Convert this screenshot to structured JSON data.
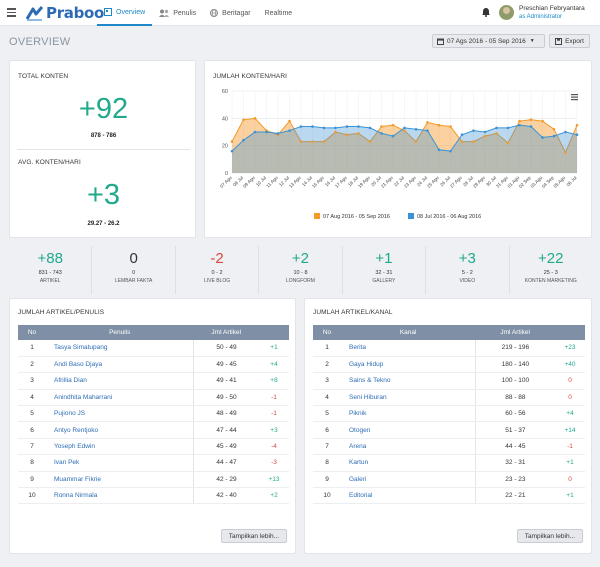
{
  "header": {
    "logo": "Praboo",
    "nav": [
      "Overview",
      "Penulis",
      "Beritagar",
      "Realtime"
    ],
    "user_name": "Preschian Febryantara",
    "user_role": "as Administrator"
  },
  "page": {
    "title": "OVERVIEW",
    "date_range": "07 Ags 2016 - 05 Sep 2016",
    "export_label": "Export"
  },
  "total": {
    "title": "TOTAL KONTEN",
    "value": "+92",
    "range": "878 - 786",
    "avg_title": "AVG. KONTEN/HARI",
    "avg_value": "+3",
    "avg_range": "29.27 - 26.2"
  },
  "chart_data": {
    "type": "area",
    "title": "JUMLAH KONTEN/HARI",
    "ylim": [
      0,
      60
    ],
    "yticks": [
      "0",
      "20",
      "40",
      "60"
    ],
    "x": [
      "07 Agu",
      "08 Jul",
      "09 Agu",
      "10 Jul",
      "11 Agu",
      "12 Jul",
      "13 Agu",
      "14 Jul",
      "15 Agu",
      "16 Jul",
      "17 Agu",
      "18 Jul",
      "19 Agu",
      "20 Jul",
      "21 Agu",
      "22 Jul",
      "23 Agu",
      "24 Jul",
      "25 Agu",
      "26 Jul",
      "27 Agu",
      "28 Jul",
      "29 Agu",
      "30 Jul",
      "31 Agu",
      "01 Agu",
      "02 Sep",
      "03 Agu",
      "04 Sep",
      "05 Agu",
      "06 Jul"
    ],
    "grid": true,
    "legend_position": "bottom",
    "series": [
      {
        "name": "07 Aug 2016 - 05 Sep 2016",
        "color": "#f39a2b",
        "values": [
          23,
          39,
          40,
          31,
          28,
          38,
          23,
          23,
          23,
          30,
          28,
          29,
          23,
          34,
          35,
          31,
          23,
          37,
          35,
          34,
          23,
          23,
          27,
          29,
          22,
          38,
          39,
          38,
          32,
          15,
          35
        ]
      },
      {
        "name": "08 Jul 2016 - 06 Aug 2016",
        "color": "#3a93d6",
        "values": [
          16,
          24,
          30,
          30,
          29,
          31,
          34,
          34,
          33,
          33,
          34,
          34,
          33,
          29,
          27,
          33,
          32,
          31,
          17,
          16,
          28,
          31,
          30,
          33,
          33,
          35,
          34,
          26,
          27,
          30,
          28
        ]
      }
    ]
  },
  "stats": [
    {
      "value": "+88",
      "range": "831 - 743",
      "label": "ARTIKEL",
      "tone": "green"
    },
    {
      "value": "0",
      "range": "0",
      "label": "LEMBAR FAKTA",
      "tone": "black"
    },
    {
      "value": "-2",
      "range": "0 - 2",
      "label": "LIVE BLOG",
      "tone": "red"
    },
    {
      "value": "+2",
      "range": "10 - 8",
      "label": "LONGFORM",
      "tone": "green"
    },
    {
      "value": "+1",
      "range": "32 - 31",
      "label": "GALLERY",
      "tone": "green"
    },
    {
      "value": "+3",
      "range": "5 - 2",
      "label": "VIDEO",
      "tone": "green"
    },
    {
      "value": "+22",
      "range": "25 - 3",
      "label": "KONTEN MARKETING",
      "tone": "green"
    }
  ],
  "penulis": {
    "title": "JUMLAH ARTIKEL/PENULIS",
    "headers": [
      "No",
      "Penulis",
      "Jml Artikel"
    ],
    "rows": [
      {
        "no": "1",
        "name": "Tasya Simatupang",
        "jml": "50 - 49",
        "diff": "+1",
        "tone": "green"
      },
      {
        "no": "2",
        "name": "Andi Baso Djaya",
        "jml": "49 - 45",
        "diff": "+4",
        "tone": "green"
      },
      {
        "no": "3",
        "name": "Afrillia Dian",
        "jml": "49 - 41",
        "diff": "+8",
        "tone": "green"
      },
      {
        "no": "4",
        "name": "Anindhita Maharrani",
        "jml": "49 - 50",
        "diff": "-1",
        "tone": "red"
      },
      {
        "no": "5",
        "name": "Pujiono JS",
        "jml": "48 - 49",
        "diff": "-1",
        "tone": "red"
      },
      {
        "no": "6",
        "name": "Antyo Rentjoko",
        "jml": "47 - 44",
        "diff": "+3",
        "tone": "green"
      },
      {
        "no": "7",
        "name": "Yoseph Edwin",
        "jml": "45 - 49",
        "diff": "-4",
        "tone": "red"
      },
      {
        "no": "8",
        "name": "Ivan Pek",
        "jml": "44 - 47",
        "diff": "-3",
        "tone": "red"
      },
      {
        "no": "9",
        "name": "Muammar Fikrie",
        "jml": "42 - 29",
        "diff": "+13",
        "tone": "green"
      },
      {
        "no": "10",
        "name": "Ronna Nirmala",
        "jml": "42 - 40",
        "diff": "+2",
        "tone": "green"
      }
    ],
    "more_label": "Tampilkan lebih..."
  },
  "kanal": {
    "title": "JUMLAH ARTIKEL/KANAL",
    "headers": [
      "No",
      "Kanal",
      "Jml Artikel"
    ],
    "rows": [
      {
        "no": "1",
        "name": "Berita",
        "jml": "219 - 196",
        "diff": "+23",
        "tone": "green"
      },
      {
        "no": "2",
        "name": "Gaya Hidup",
        "jml": "180 - 140",
        "diff": "+40",
        "tone": "green"
      },
      {
        "no": "3",
        "name": "Sains & Tekno",
        "jml": "100 - 100",
        "diff": "0",
        "tone": "red"
      },
      {
        "no": "4",
        "name": "Seni Hiburan",
        "jml": "88 - 88",
        "diff": "0",
        "tone": "red"
      },
      {
        "no": "5",
        "name": "Piknik",
        "jml": "60 - 56",
        "diff": "+4",
        "tone": "green"
      },
      {
        "no": "6",
        "name": "Otogen",
        "jml": "51 - 37",
        "diff": "+14",
        "tone": "green"
      },
      {
        "no": "7",
        "name": "Arena",
        "jml": "44 - 45",
        "diff": "-1",
        "tone": "red"
      },
      {
        "no": "8",
        "name": "Kartun",
        "jml": "32 - 31",
        "diff": "+1",
        "tone": "green"
      },
      {
        "no": "9",
        "name": "Galeri",
        "jml": "23 - 23",
        "diff": "0",
        "tone": "red"
      },
      {
        "no": "10",
        "name": "Editorial",
        "jml": "22 - 21",
        "diff": "+1",
        "tone": "green"
      }
    ],
    "more_label": "Tampilkan lebih..."
  }
}
